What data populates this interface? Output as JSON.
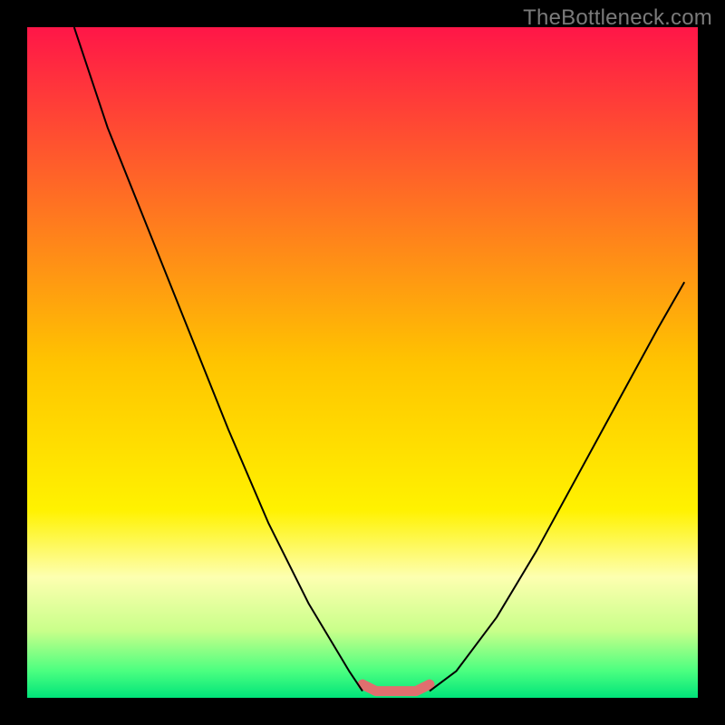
{
  "watermark": "TheBottleneck.com",
  "chart_data": {
    "type": "line",
    "title": "",
    "xlabel": "",
    "ylabel": "",
    "xlim": [
      0,
      100
    ],
    "ylim": [
      0,
      100
    ],
    "grid": false,
    "legend": false,
    "background_gradient": {
      "stops": [
        {
          "offset": 0.0,
          "color": "#ff1648"
        },
        {
          "offset": 0.5,
          "color": "#ffc400"
        },
        {
          "offset": 0.72,
          "color": "#fff200"
        },
        {
          "offset": 0.82,
          "color": "#fdffb0"
        },
        {
          "offset": 0.9,
          "color": "#c9ff8a"
        },
        {
          "offset": 0.96,
          "color": "#4bff80"
        },
        {
          "offset": 1.0,
          "color": "#00e47a"
        }
      ]
    },
    "series": [
      {
        "name": "left-branch",
        "color": "#000000",
        "width": 2,
        "x": [
          7,
          12,
          18,
          24,
          30,
          36,
          42,
          48,
          50
        ],
        "y": [
          100,
          85,
          70,
          55,
          40,
          26,
          14,
          4,
          1
        ]
      },
      {
        "name": "right-branch",
        "color": "#000000",
        "width": 2,
        "x": [
          60,
          64,
          70,
          76,
          82,
          88,
          94,
          98
        ],
        "y": [
          1,
          4,
          12,
          22,
          33,
          44,
          55,
          62
        ]
      },
      {
        "name": "flat-highlight",
        "color": "#e06f6f",
        "width": 11,
        "linecap": "round",
        "x": [
          50,
          52,
          55,
          58,
          60
        ],
        "y": [
          2,
          1,
          1,
          1,
          2
        ]
      }
    ]
  }
}
